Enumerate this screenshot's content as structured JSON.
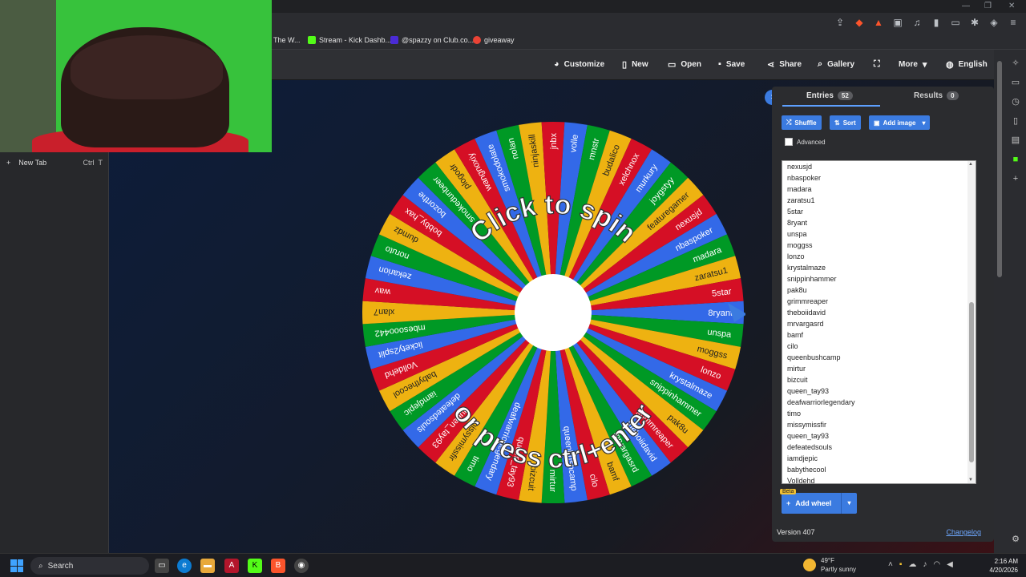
{
  "bookmarks": [
    {
      "label": "The W...",
      "color": "#888888"
    },
    {
      "label": "Stream - Kick Dashb...",
      "color": "#53fc18"
    },
    {
      "label": "@spazzy on Club.co...",
      "color": "#4a2bd6"
    },
    {
      "label": "giveaway",
      "color": "#ea4335"
    }
  ],
  "tab_sidebar": {
    "new_tab": "New Tab",
    "shortcut_ctrl": "Ctrl",
    "shortcut_key": "T"
  },
  "toolbar": {
    "customize": "Customize",
    "new": "New",
    "open": "Open",
    "save": "Save",
    "share": "Share",
    "gallery": "Gallery",
    "more": "More",
    "language": "English"
  },
  "wheel": {
    "top_text": "Click to spin",
    "bottom_text": "or press ctrl+enter",
    "colors": [
      "#3369e8",
      "#009925",
      "#eeb211",
      "#d50f25"
    ],
    "slices": [
      "8ryant",
      "unspa",
      "moggss",
      "lonzo",
      "krystalmaze",
      "snippinhammer",
      "pak8u",
      "grimmreaper",
      "theboiidavid",
      "mrvargasrd",
      "bamf",
      "cilo",
      "queenbushcamp",
      "mirtur",
      "bizcuit",
      "queen_tay93",
      "deafwarriorlegendary",
      "timo",
      "missymissfir",
      "queen_tay93",
      "defeatedsouls",
      "iamdjepic",
      "babythecool",
      "Volldehd",
      "lickety2split",
      "mbesooo442",
      "xlan7",
      "wav",
      "zekarion",
      "noruto",
      "dumdz",
      "bobby_hax",
      "bozorthe",
      "smokedunbeer",
      "plogodr",
      "wangnoxiy",
      "smokodolate",
      "nolan",
      "ninjaskill",
      "jnbx",
      "volle",
      "mnstr",
      "budalico",
      "xelchnox",
      "murkury",
      "joygstyy",
      "featuregamer",
      "nexusjd",
      "nbaspoker",
      "madara",
      "zaratsu1",
      "5star"
    ]
  },
  "panel": {
    "entries_label": "Entries",
    "entries_count": "52",
    "results_label": "Results",
    "results_count": "0",
    "shuffle": "Shuffle",
    "sort": "Sort",
    "add_image": "Add image",
    "advanced": "Advanced",
    "entries": [
      "nexusjd",
      "nbaspoker",
      "madara",
      "zaratsu1",
      "5star",
      "8ryant",
      "unspa",
      "moggss",
      "lonzo",
      "krystalmaze",
      "snippinhammer",
      "pak8u",
      "grimmreaper",
      "theboiidavid",
      "mrvargasrd",
      "bamf",
      "cilo",
      "queenbushcamp",
      "mirtur",
      "bizcuit",
      "queen_tay93",
      "deafwarriorlegendary",
      "timo",
      "missymissfir",
      "queen_tay93",
      "defeatedsouls",
      "iamdjepic",
      "babythecool",
      "Volldehd"
    ],
    "beta": "Beta",
    "add_wheel": "Add wheel",
    "version": "Version 407",
    "changelog": "Changelog"
  },
  "taskbar": {
    "search": "Search",
    "temp": "49°F",
    "weather": "Partly sunny",
    "time": "2:16 AM",
    "date": "4/20/2026"
  }
}
